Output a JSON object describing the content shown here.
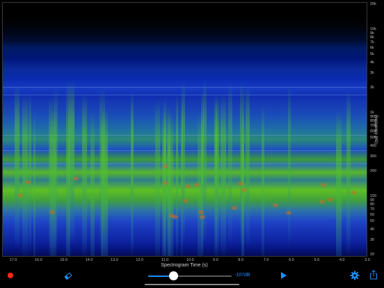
{
  "spectrogram": {
    "frequency_axis": {
      "title": "Frequency (Hz)",
      "tick_labels": [
        "20k",
        "10k",
        "9k",
        "8k",
        "7k",
        "6k",
        "5k",
        "4k",
        "3k",
        "2k",
        "1k",
        "900",
        "800",
        "700",
        "600",
        "500",
        "400",
        "300",
        "200",
        "100",
        "90",
        "80",
        "70",
        "60",
        "50",
        "40",
        "30",
        "20"
      ],
      "scale": "log"
    },
    "time_axis": {
      "title": "Spectrogram Time (s)",
      "tick_labels": [
        "17.0",
        "16.0",
        "15.0",
        "14.0",
        "13.0",
        "12.0",
        "11.0",
        "10.0",
        "9.0",
        "8.0",
        "7.0",
        "6.0",
        "5.0",
        "4.0",
        "3.0"
      ]
    },
    "colormap": [
      "#000000",
      "#0a2a99",
      "#1f6fa6",
      "#5fbf23",
      "#c86e28"
    ]
  },
  "toolbar": {
    "record_icon": "record-icon",
    "eraser_icon": "eraser-icon",
    "gain_slider": {
      "value_fraction": 0.3,
      "value_label": "-107dB"
    },
    "play_icon": "play-icon",
    "settings_icon": "gear-icon",
    "share_icon": "share-icon"
  },
  "colors": {
    "accent": "#1e8fff",
    "record": "#ff2a1a",
    "background": "#000000"
  }
}
